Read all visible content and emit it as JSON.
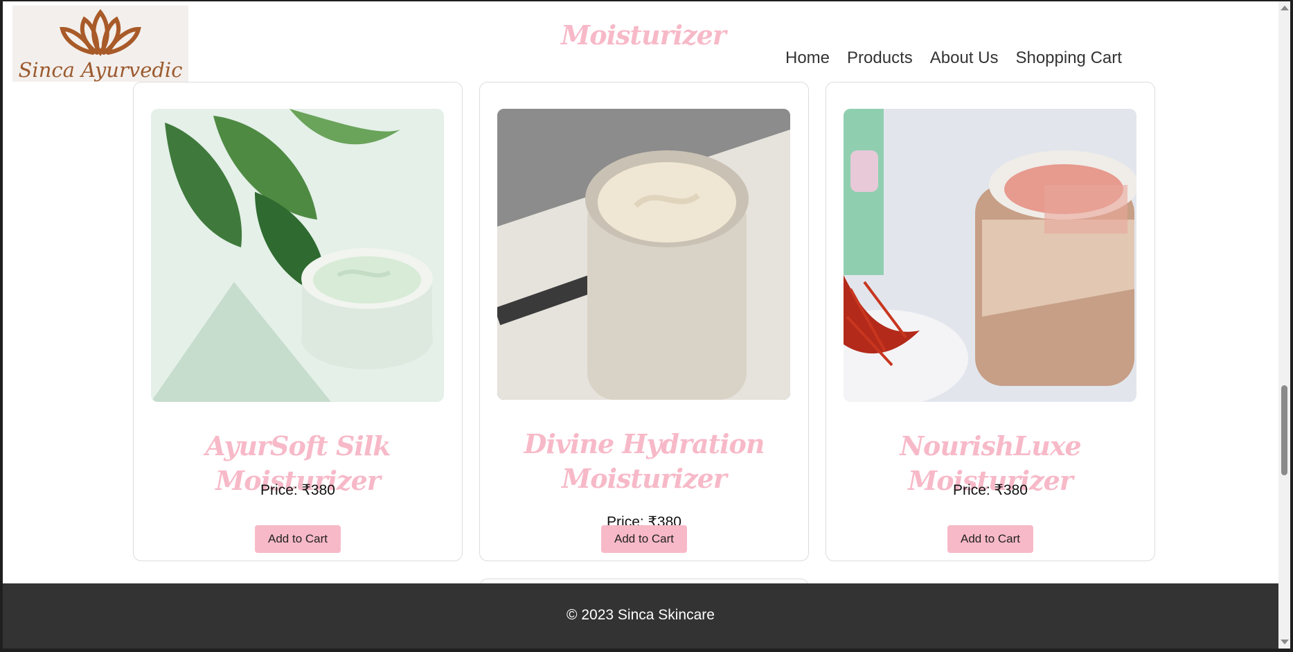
{
  "header": {
    "logo_text": "Sinca Ayurvedic",
    "page_title": "Moisturizer",
    "nav": [
      "Home",
      "Products",
      "About Us",
      "Shopping Cart"
    ]
  },
  "products": [
    {
      "name": "AyurSoft Silk Moisturizer",
      "price": "Price: ₹380",
      "button": "Add to Cart"
    },
    {
      "name": "Divine Hydration Moisturizer",
      "price": "Price: ₹380",
      "button": "Add to Cart"
    },
    {
      "name": "NourishLuxe Moisturizer",
      "price": "Price: ₹380",
      "button": "Add to Cart"
    }
  ],
  "footer": {
    "text": "© 2023 Sinca Skincare"
  },
  "colors": {
    "accent_pink": "#f7b9c8",
    "logo_brown": "#9b5a2e",
    "footer_bg": "#333333"
  }
}
